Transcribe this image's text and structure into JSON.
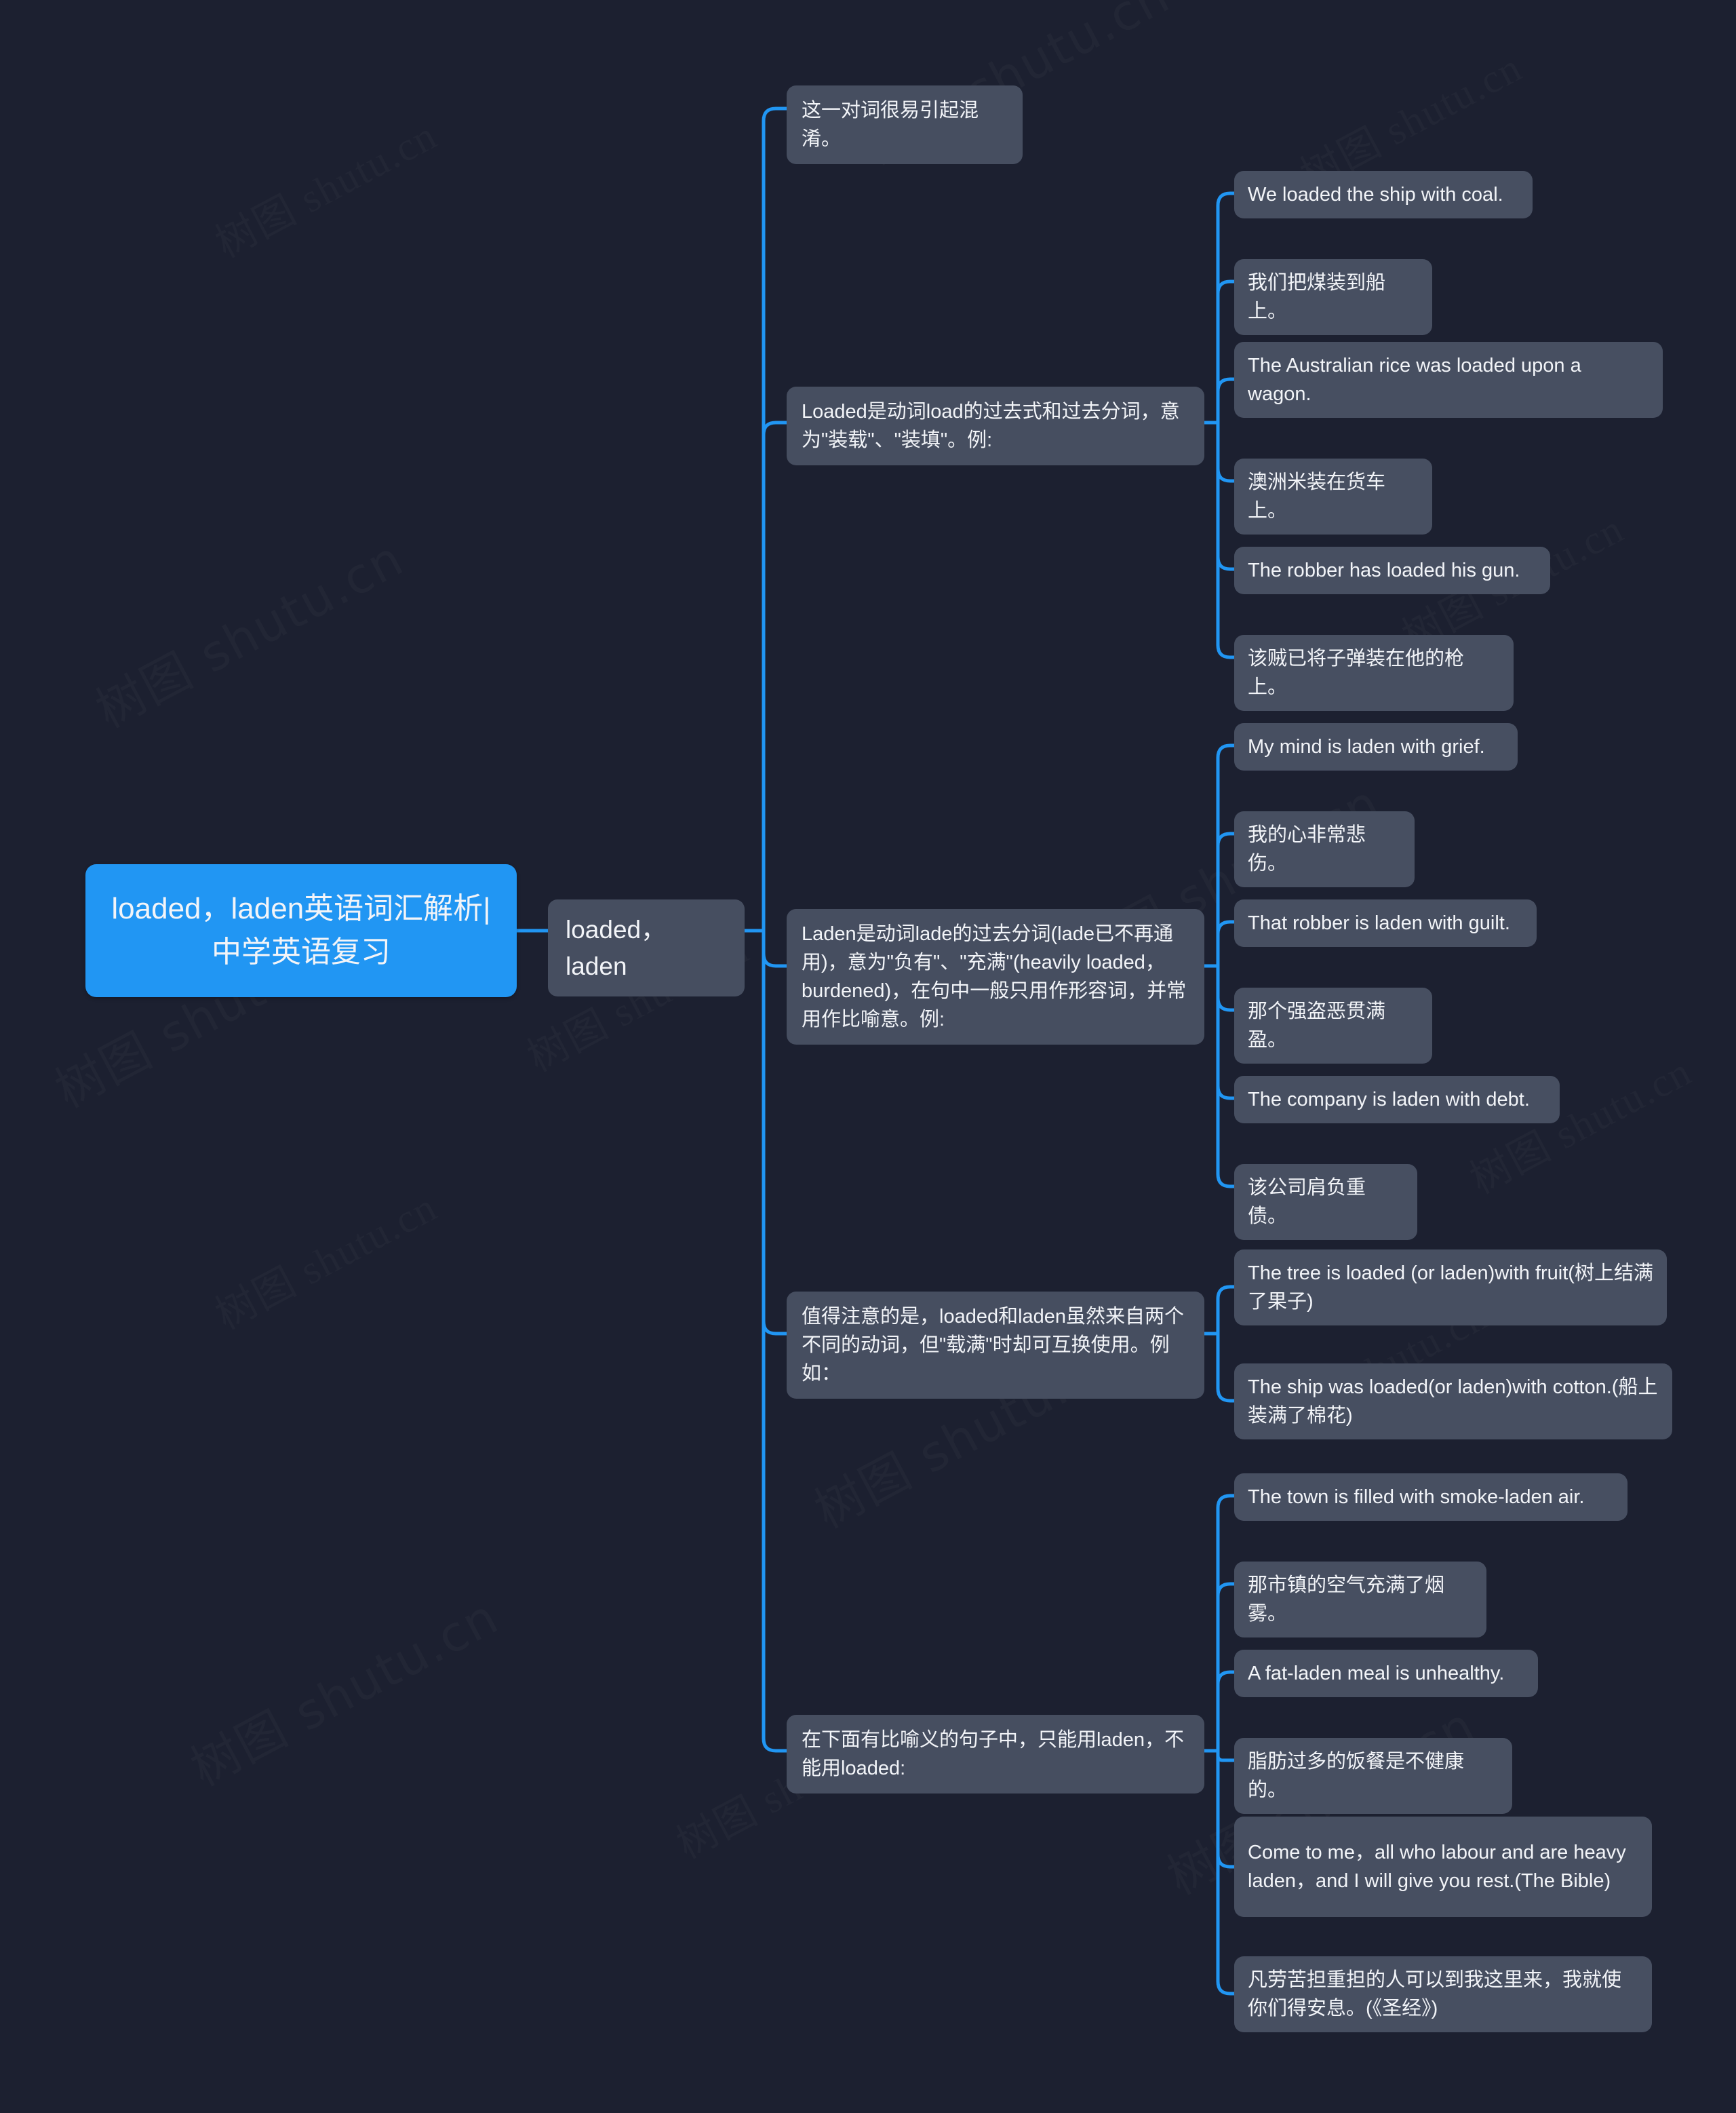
{
  "theme": {
    "background": "#1c2030",
    "root_fill": "#2196f3",
    "node_fill": "#464e60",
    "link_color": "#2196f3",
    "text_color": "#f2f4f8"
  },
  "watermark": {
    "text_cjk": "树图",
    "text_latin": "shutu.cn",
    "combined": "树图 shutu.cn"
  },
  "mindmap": {
    "root": {
      "label": "loaded，laden英语词汇解析|中学英语复习"
    },
    "level2": {
      "label": "loaded，laden"
    },
    "branches": [
      {
        "id": "branch-confusion",
        "label": "这一对词很易引起混淆。",
        "children": []
      },
      {
        "id": "branch-loaded",
        "label": "Loaded是动词load的过去式和过去分词，意为\"装载\"、\"装填\"。例:",
        "children": [
          {
            "id": "leaf-loaded-en-1",
            "label": "We loaded the ship with coal."
          },
          {
            "id": "leaf-loaded-zh-1",
            "label": "我们把煤装到船上。"
          },
          {
            "id": "leaf-loaded-en-2",
            "label": "The Australian rice was loaded upon a wagon."
          },
          {
            "id": "leaf-loaded-zh-2",
            "label": "澳洲米装在货车上。"
          },
          {
            "id": "leaf-loaded-en-3",
            "label": "The robber has loaded his gun."
          },
          {
            "id": "leaf-loaded-zh-3",
            "label": "该贼已将子弹装在他的枪上。"
          }
        ]
      },
      {
        "id": "branch-laden",
        "label": "Laden是动词lade的过去分词(lade已不再通用)，意为\"负有\"、\"充满\"(heavily loaded，burdened)，在句中一般只用作形容词，并常用作比喻意。例:",
        "children": [
          {
            "id": "leaf-laden-en-1",
            "label": "My mind is laden with grief."
          },
          {
            "id": "leaf-laden-zh-1",
            "label": "我的心非常悲伤。"
          },
          {
            "id": "leaf-laden-en-2",
            "label": "That robber is laden with guilt."
          },
          {
            "id": "leaf-laden-zh-2",
            "label": "那个强盗恶贯满盈。"
          },
          {
            "id": "leaf-laden-en-3",
            "label": "The company is laden with debt."
          },
          {
            "id": "leaf-laden-zh-3",
            "label": "该公司肩负重债。"
          }
        ]
      },
      {
        "id": "branch-interchangeable",
        "label": "值得注意的是，loaded和laden虽然来自两个不同的动词，但\"载满\"时却可互换使用。例如：",
        "children": [
          {
            "id": "leaf-inter-1",
            "label": "The tree is loaded (or laden)with fruit(树上结满了果子)"
          },
          {
            "id": "leaf-inter-2",
            "label": "The ship was loaded(or laden)with cotton.(船上装满了棉花)"
          }
        ]
      },
      {
        "id": "branch-figurative",
        "label": "在下面有比喻义的句子中，只能用laden，不能用loaded:",
        "children": [
          {
            "id": "leaf-fig-en-1",
            "label": "The town is filled with smoke-laden air."
          },
          {
            "id": "leaf-fig-zh-1",
            "label": "那市镇的空气充满了烟雾。"
          },
          {
            "id": "leaf-fig-en-2",
            "label": "A fat-laden meal is unhealthy."
          },
          {
            "id": "leaf-fig-zh-2",
            "label": "脂肪过多的饭餐是不健康的。"
          },
          {
            "id": "leaf-fig-en-3",
            "label": "Come to me，all who labour and are heavy laden，and I will give you rest.(The Bible)"
          },
          {
            "id": "leaf-fig-zh-3",
            "label": "凡劳苦担重担的人可以到我这里来，我就使你们得安息。(《圣经》)"
          }
        ]
      }
    ]
  }
}
